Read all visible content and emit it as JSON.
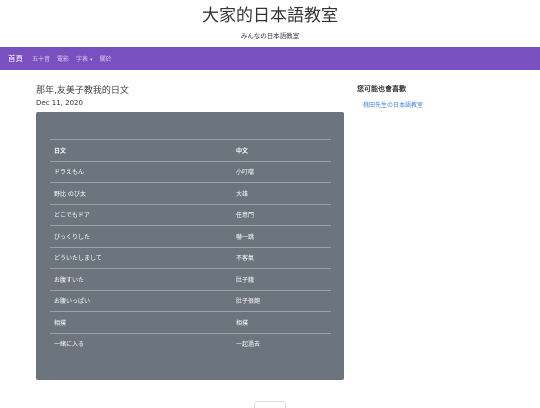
{
  "site": {
    "title": "大家的日本語教室",
    "subtitle": "みんなの日本語教室"
  },
  "nav": {
    "brand": "首頁",
    "items": [
      "五十音",
      "電影",
      "字表",
      "關於"
    ],
    "dropdown_caret": "▾"
  },
  "post": {
    "title": "那年,友美子教我的日文",
    "date": "Dec 11, 2020"
  },
  "table": {
    "headers": [
      "日文",
      "中文"
    ],
    "rows": [
      [
        "ドラえもん",
        "小叮噹"
      ],
      [
        "野比 のび太",
        "大雄"
      ],
      [
        "どこでもドア",
        "任意門"
      ],
      [
        "びっくりした",
        "嚇一跳"
      ],
      [
        "どういたしまして",
        "不客氣"
      ],
      [
        "お腹すいた",
        "肚子餓"
      ],
      [
        "お腹いっぱい",
        "肚子很飽"
      ],
      [
        "相撲",
        "相撲"
      ],
      [
        "一緒に入る",
        "一起過去"
      ]
    ]
  },
  "sidebar": {
    "heading": "您可能也會喜歡",
    "link": "桃田先生の日本語教室"
  }
}
